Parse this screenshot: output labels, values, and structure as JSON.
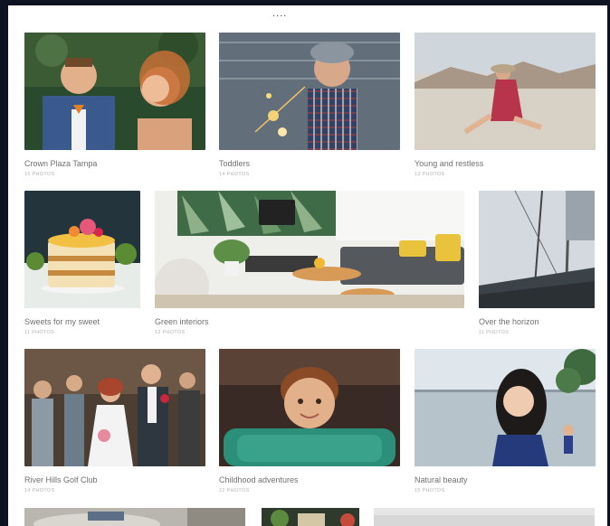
{
  "header": {
    "partial_title": "...."
  },
  "albums": [
    {
      "title": "Crown Plaza Tampa",
      "count": "16 PHOTOS"
    },
    {
      "title": "Toddlers",
      "count": "14 PHOTOS"
    },
    {
      "title": "Young and restless",
      "count": "12 PHOTOS"
    },
    {
      "title": "Sweets for my sweet",
      "count": "11 PHOTOS"
    },
    {
      "title": "Green interiors",
      "count": "12 PHOTOS"
    },
    {
      "title": "Over the horizon",
      "count": "11 PHOTOS"
    },
    {
      "title": "River Hills Golf Club",
      "count": "14 PHOTOS"
    },
    {
      "title": "Childhood adventures",
      "count": "22 PHOTOS"
    },
    {
      "title": "Natural beauty",
      "count": "15 PHOTOS"
    }
  ],
  "colors": {
    "page_bg": "#0f1220",
    "card_bg": "#ffffff",
    "title_text": "#6f6f6f",
    "count_text": "#b3b3b3"
  }
}
